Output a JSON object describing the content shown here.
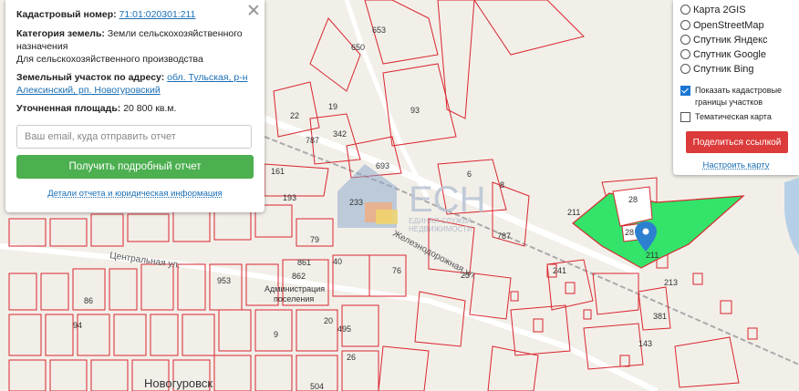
{
  "info_panel": {
    "cadastral_label": "Кадастровый номер:",
    "cadastral_number": "71:01:020301:211",
    "category_label": "Категория земель:",
    "category_value": "Земли сельскохозяйственного назначения",
    "usage_value": "Для сельскохозяйственного производства",
    "address_label": "Земельный участок по адресу:",
    "address_value": "обл. Тульская, р-н Алексинский, рп. Новогуровский",
    "area_label": "Уточненная площадь:",
    "area_value": "20 800 кв.м.",
    "email_placeholder": "Ваш email, куда отправить отчет",
    "report_button": "Получить подробный отчет",
    "details_link": "Детали отчета и юридическая информация"
  },
  "layer_panel": {
    "base_layers": [
      "Карта 2GIS",
      "OpenStreetMap",
      "Спутник Яндекс",
      "Спутник Google",
      "Спутник Bing"
    ],
    "cadastral_borders": {
      "label": "Показать кадастровые границы участков",
      "checked": true
    },
    "thematic_map": {
      "label": "Тематическая карта",
      "checked": false
    },
    "share_button": "Поделиться ссылкой",
    "configure_link": "Настроить карту"
  },
  "map": {
    "watermark": "ЕСН",
    "watermark_sub1": "ЕДИНАЯ СЛУЖБА",
    "watermark_sub2": "НЕДВИЖИМОСТИ",
    "town_label": "Новогуровск",
    "street_central": "Центральная ул.",
    "street_railway": "Железнодорожная ул.",
    "admin_label1": "Администрация",
    "admin_label2": "поселения",
    "parcel_labels": [
      "653",
      "650",
      "93",
      "19",
      "787",
      "342",
      "22",
      "693",
      "161",
      "193",
      "233",
      "6",
      "8",
      "787",
      "28",
      "211",
      "28",
      "211",
      "79",
      "861",
      "40",
      "76",
      "862",
      "20",
      "495",
      "23",
      "241",
      "213",
      "86",
      "94",
      "953",
      "143",
      "381",
      "504",
      "9",
      "26"
    ],
    "colors": {
      "parcel_border": "#d9262e",
      "selected_parcel": "#33e36a",
      "marker": "#2d7fd0"
    }
  }
}
